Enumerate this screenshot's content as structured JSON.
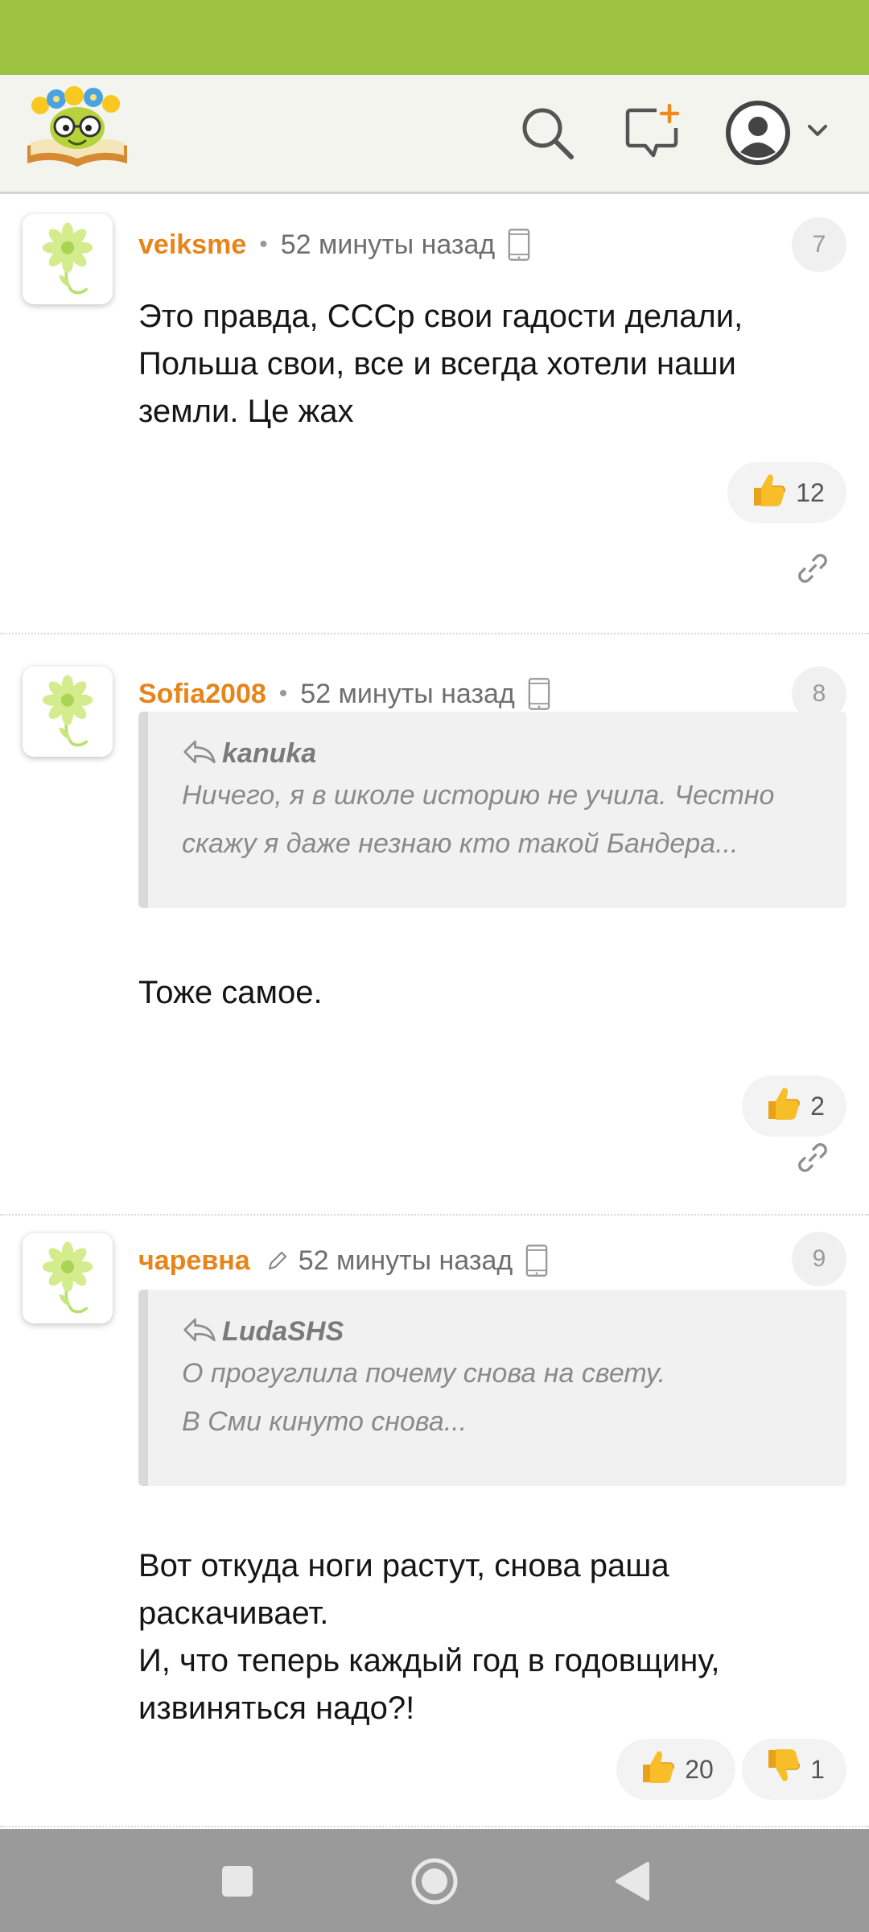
{
  "header": {
    "logo_icon": "smiling-book-logo-icon",
    "search_icon": "search-icon",
    "new_post_icon": "new-message-plus-icon",
    "profile_icon": "user-avatar-icon",
    "menu_icon": "chevron-down-icon"
  },
  "comments": [
    {
      "number": "7",
      "author": "veiksme",
      "separator": "•",
      "time": "52 минуты назад",
      "device_icon": "mobile-phone-icon",
      "text_lines": [
        "Это правда, СССр свои гадости делали,",
        "Польша свои, все и всегда хотели наши",
        "земли. Це жах"
      ],
      "likes": "12"
    },
    {
      "number": "8",
      "author": "Sofia2008",
      "separator": "•",
      "time": "52 минуты назад",
      "device_icon": "mobile-phone-icon",
      "quote": {
        "author": "kanuka",
        "lines": [
          "Ничего, я в школе историю не учила. Честно",
          "скажу я даже незнаю кто такой Бандера..."
        ]
      },
      "text_lines": [
        "Тоже самое."
      ],
      "likes": "2"
    },
    {
      "number": "9",
      "author": "чаревна",
      "time": "52 минуты назад",
      "device_icon": "mobile-phone-icon",
      "edited_icon": "pencil-icon",
      "quote": {
        "author": "LudaSHS",
        "lines": [
          "О прогуглила почему снова на свету.",
          "В Сми кинуто снова..."
        ]
      },
      "text_lines": [
        "Вот откуда ноги растут, снова раша",
        "раскачивает.",
        "И, что теперь каждый год в годовщину,",
        "извиняться надо?!"
      ],
      "likes": "20",
      "dislikes": "1"
    }
  ],
  "colors": {
    "status_bar": "#9dc242",
    "author": "#e7841a",
    "header_bg": "#f4f4ee",
    "nav_bar": "#9a9a9a"
  },
  "nav": {
    "recents_icon": "square-recents-icon",
    "home_icon": "circle-home-icon",
    "back_icon": "triangle-back-icon"
  }
}
